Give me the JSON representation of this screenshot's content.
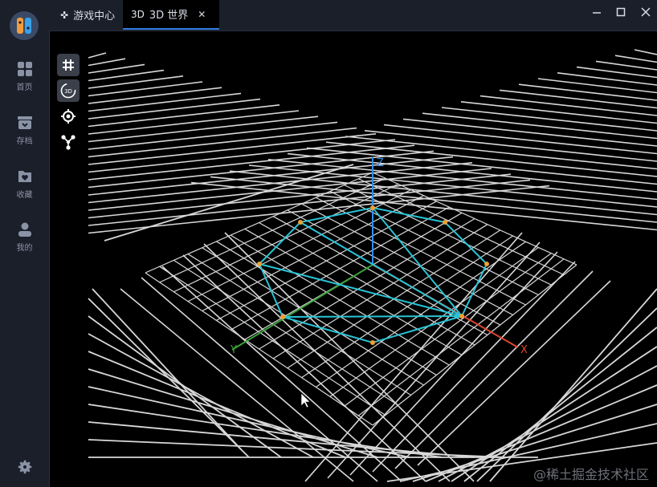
{
  "app": {
    "nav": [
      {
        "label": "首页",
        "icon": "grid-icon"
      },
      {
        "label": "存档",
        "icon": "archive-icon"
      },
      {
        "label": "收藏",
        "icon": "favorite-icon"
      },
      {
        "label": "我的",
        "icon": "user-icon"
      }
    ],
    "settings_icon": "gear-icon"
  },
  "tabs": [
    {
      "label": "游戏中心",
      "icon": "gamepad-icon",
      "active": false
    },
    {
      "label": "3D 世界",
      "icon_text": "3D",
      "active": true,
      "closable": true
    }
  ],
  "tools": [
    {
      "icon": "grid-toggle-icon",
      "active": true
    },
    {
      "icon": "rotate-3d-icon",
      "icon_text": "3D",
      "active": true
    },
    {
      "icon": "target-icon",
      "active": false
    },
    {
      "icon": "molecule-icon",
      "active": false
    }
  ],
  "scene": {
    "axes": {
      "x": "X",
      "y": "Y",
      "z": "Z"
    },
    "colors": {
      "x": "#e0452f",
      "y": "#3aa13a",
      "z": "#2f8ee8",
      "mesh": "#29c4d6",
      "vertex": "#f0a030",
      "grid": "#d8d8d8"
    }
  },
  "watermark": "@稀土掘金技术社区"
}
